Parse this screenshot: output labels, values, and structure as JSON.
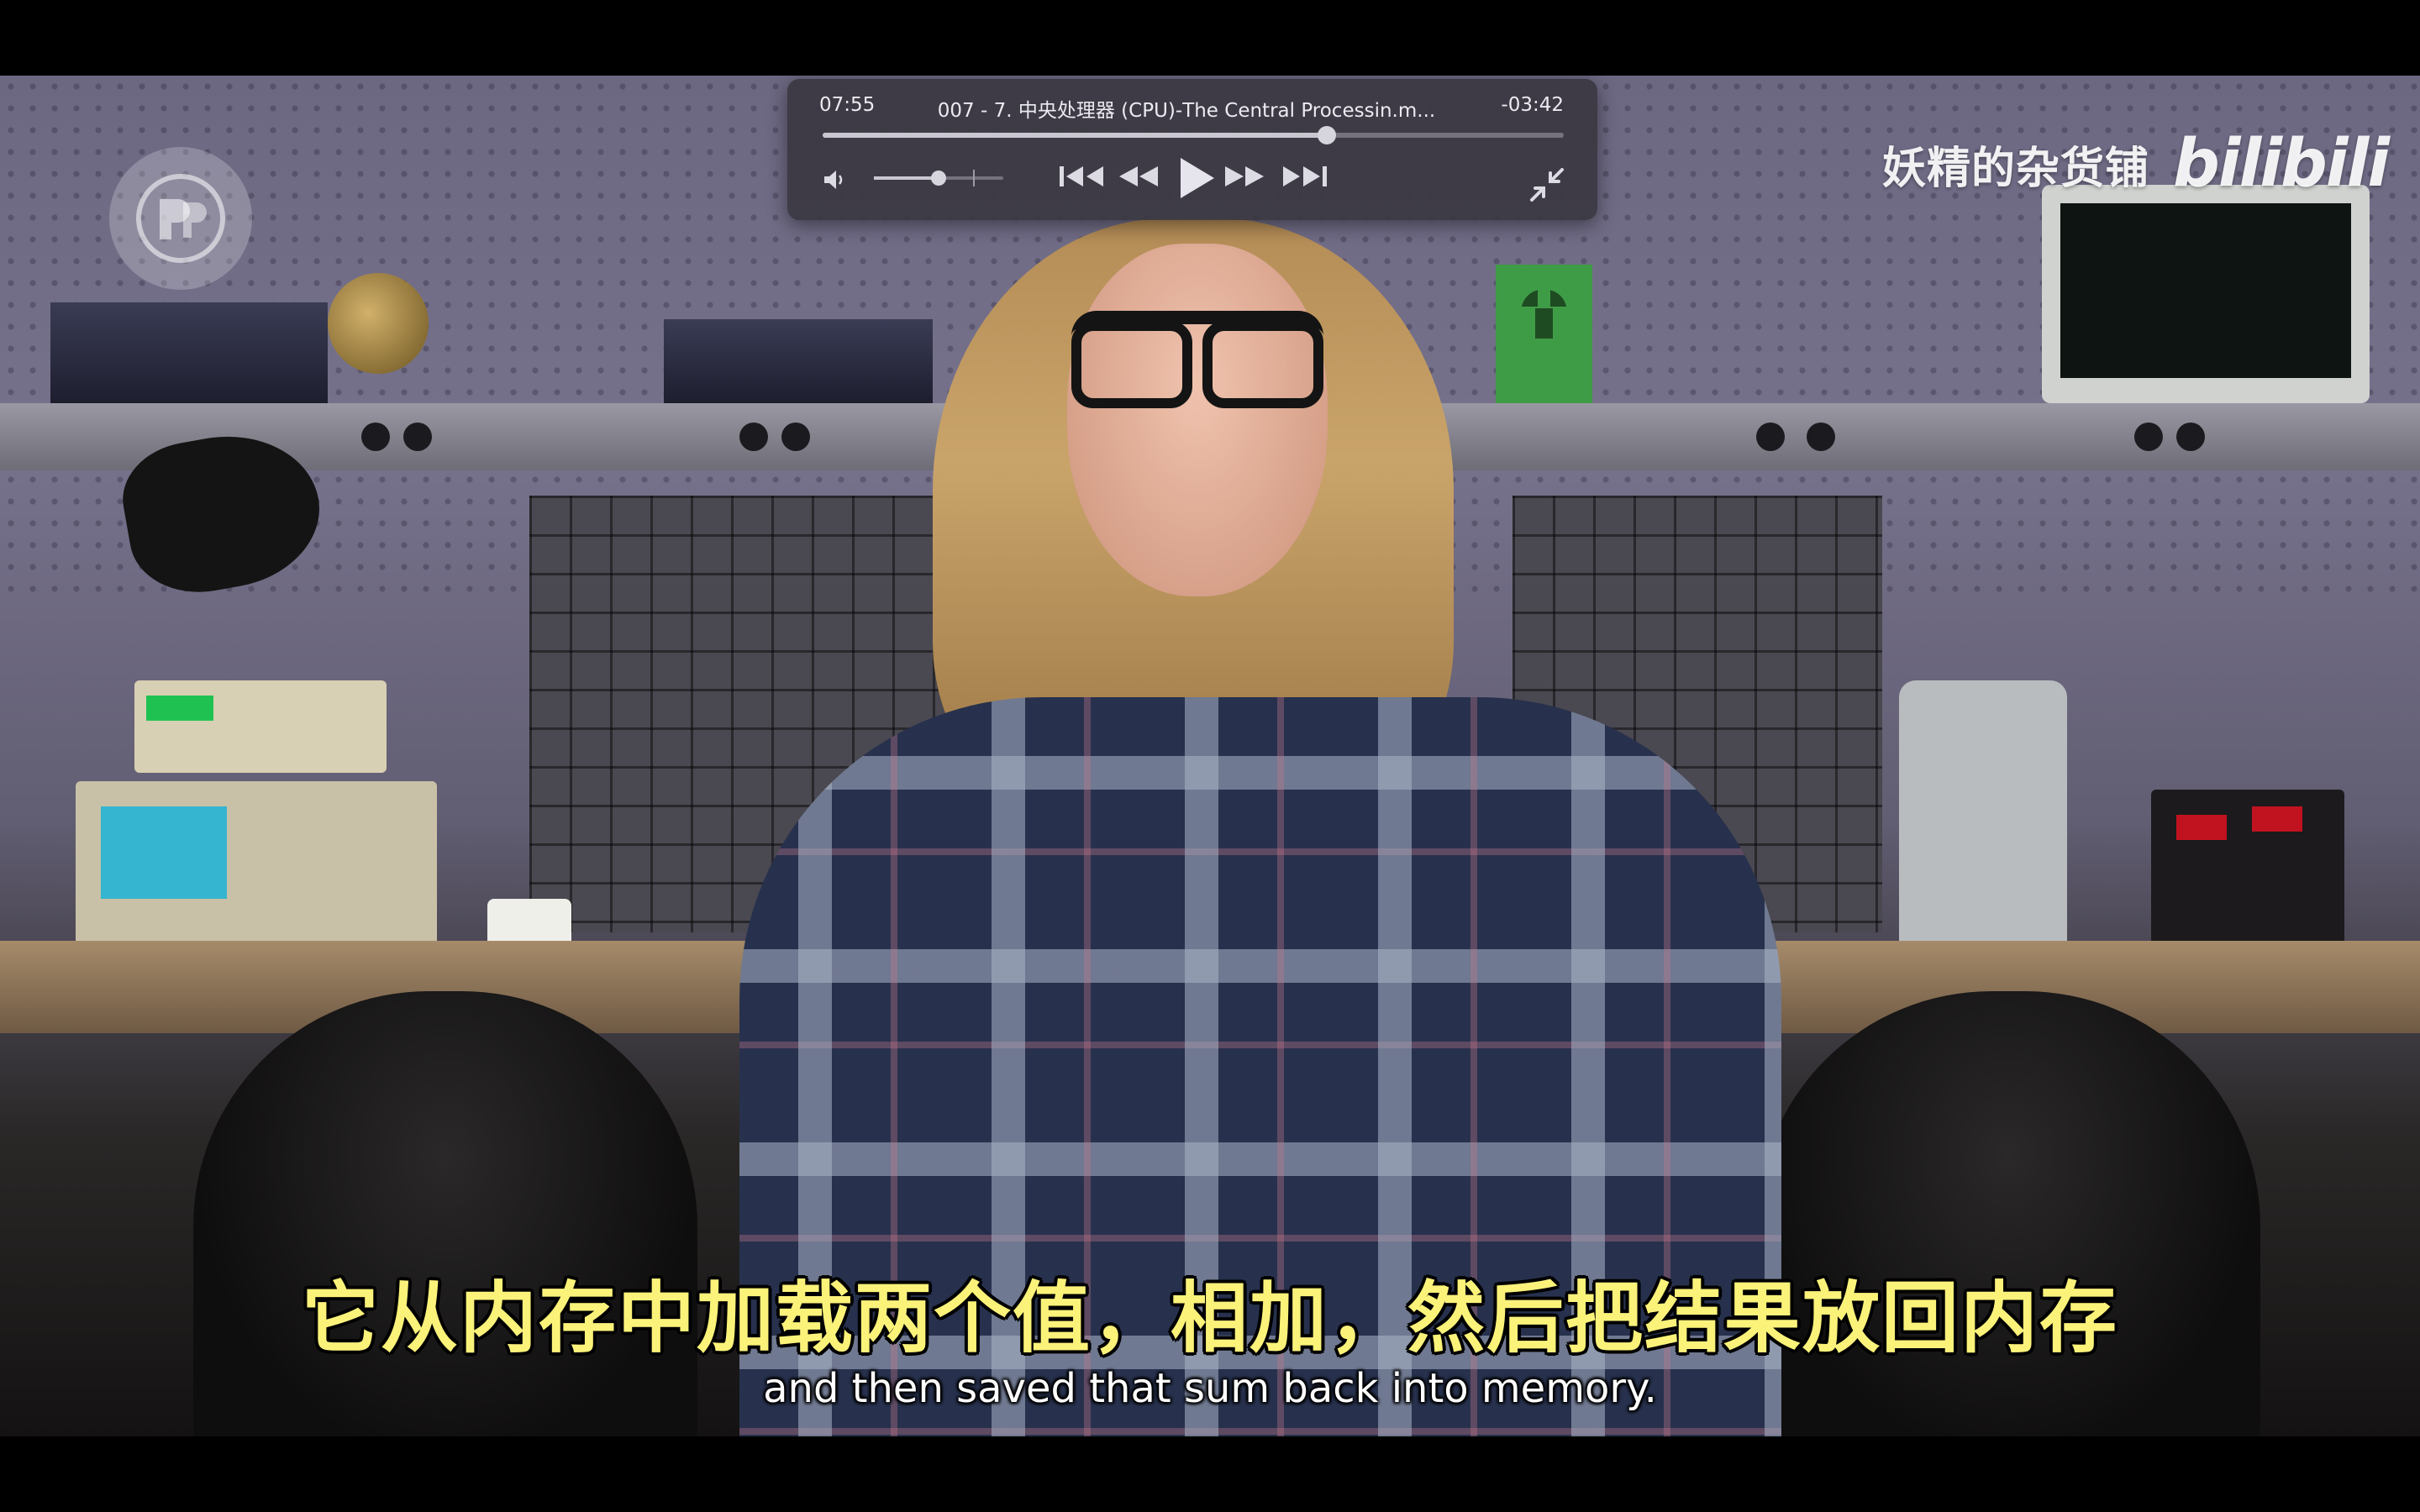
{
  "player": {
    "elapsed": "07:55",
    "title": "007 - 7. 中央处理器 (CPU)-The Central Processin.m...",
    "remaining": "-03:42",
    "progress_fraction": 0.68,
    "volume_fraction": 0.5,
    "buttons": [
      "skip-to-start-icon",
      "rewind-icon",
      "play-icon",
      "fast-forward-icon",
      "skip-to-end-icon",
      "volume-icon",
      "exit-fullscreen-icon"
    ]
  },
  "watermark": {
    "text": "妖精的杂货铺",
    "brand": "bilibili"
  },
  "subtitles": {
    "chinese": "它从内存中加载两个值，相加，然后把结果放回内存",
    "english": "and then saved that sum back into memory."
  },
  "colors": {
    "subtitle_cn": "#fbf27a",
    "controls_bg": "#3a3842"
  }
}
